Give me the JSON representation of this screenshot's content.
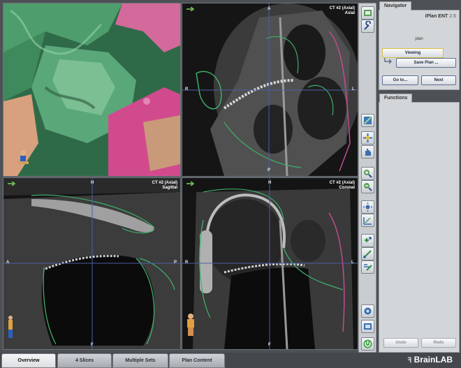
{
  "views": {
    "axial": {
      "series": "CT #2 (Axial)",
      "plane": "Axial",
      "top": "A",
      "bottom": "P",
      "left": "R",
      "right": "L"
    },
    "sagittal": {
      "series": "CT #2 (Axial)",
      "plane": "Sagittal",
      "top": "H",
      "bottom": "F",
      "left": "A",
      "right": "P"
    },
    "coronal": {
      "series": "CT #2 (Axial)",
      "plane": "Coronal",
      "top": "H",
      "bottom": "F",
      "left": "R",
      "right": "L"
    }
  },
  "navigator": {
    "tab": "Navigator",
    "product": "iPlan ENT",
    "version": "2.6",
    "step": "plan",
    "viewing_label": "Viewing",
    "save_plan_label": "Save Plan ...",
    "goto_label": "Go to...",
    "next_label": "Next"
  },
  "functions": {
    "tab": "Functions",
    "undo_label": "Undo",
    "redo_label": "Redo"
  },
  "bottom_tabs": [
    "Overview",
    "4 Slices",
    "Multiple Sets",
    "Plan Content"
  ],
  "active_tab": "Overview",
  "logo": "BrainLAB",
  "toolbar_icons": [
    "layout-icon",
    "settings-wrench-icon",
    "slice-edit-icon",
    "pan-icon",
    "hand-icon",
    "zoom-in-icon",
    "zoom-out-icon",
    "brightness-icon",
    "measure-icon",
    "add-point-icon",
    "add-trajectory-icon",
    "move-point-icon",
    "screenshot-icon",
    "film-icon",
    "power-icon"
  ]
}
